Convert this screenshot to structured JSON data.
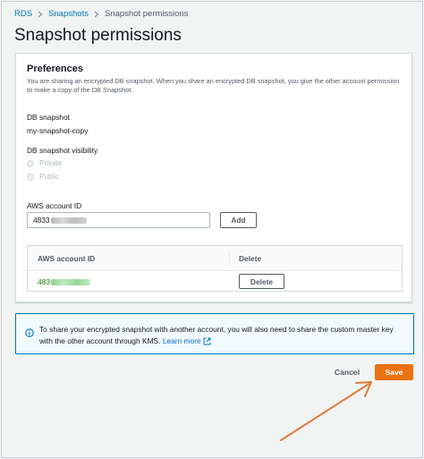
{
  "breadcrumb": {
    "items": [
      "RDS",
      "Snapshots",
      "Snapshot permissions"
    ]
  },
  "page_title": "Snapshot permissions",
  "preferences": {
    "title": "Preferences",
    "description": "You are sharing an encrypted DB snapshot. When you share an encrypted DB snapshot, you give the other account permission to make a copy of the DB Snapshot.",
    "db_snapshot_label": "DB snapshot",
    "db_snapshot_value": "my-snapshot-copy",
    "visibility_label": "DB snapshot visibility",
    "visibility_options": [
      "Private",
      "Public"
    ],
    "account_id_label": "AWS account ID",
    "account_id_value": "4833",
    "add_label": "Add"
  },
  "accounts_table": {
    "columns": [
      "AWS account ID",
      "Delete"
    ],
    "rows": [
      {
        "account_id": "483",
        "delete_label": "Delete"
      }
    ]
  },
  "info_alert": {
    "text": "To share your encrypted snapshot with another account, you will also need to share the custom master key with the other account through KMS.",
    "link_text": "Learn more"
  },
  "actions": {
    "cancel_label": "Cancel",
    "save_label": "Save"
  },
  "colors": {
    "link": "#0073bb",
    "primary": "#ec7211",
    "account_link": "#1d8102",
    "arrow": "#e07b39"
  }
}
